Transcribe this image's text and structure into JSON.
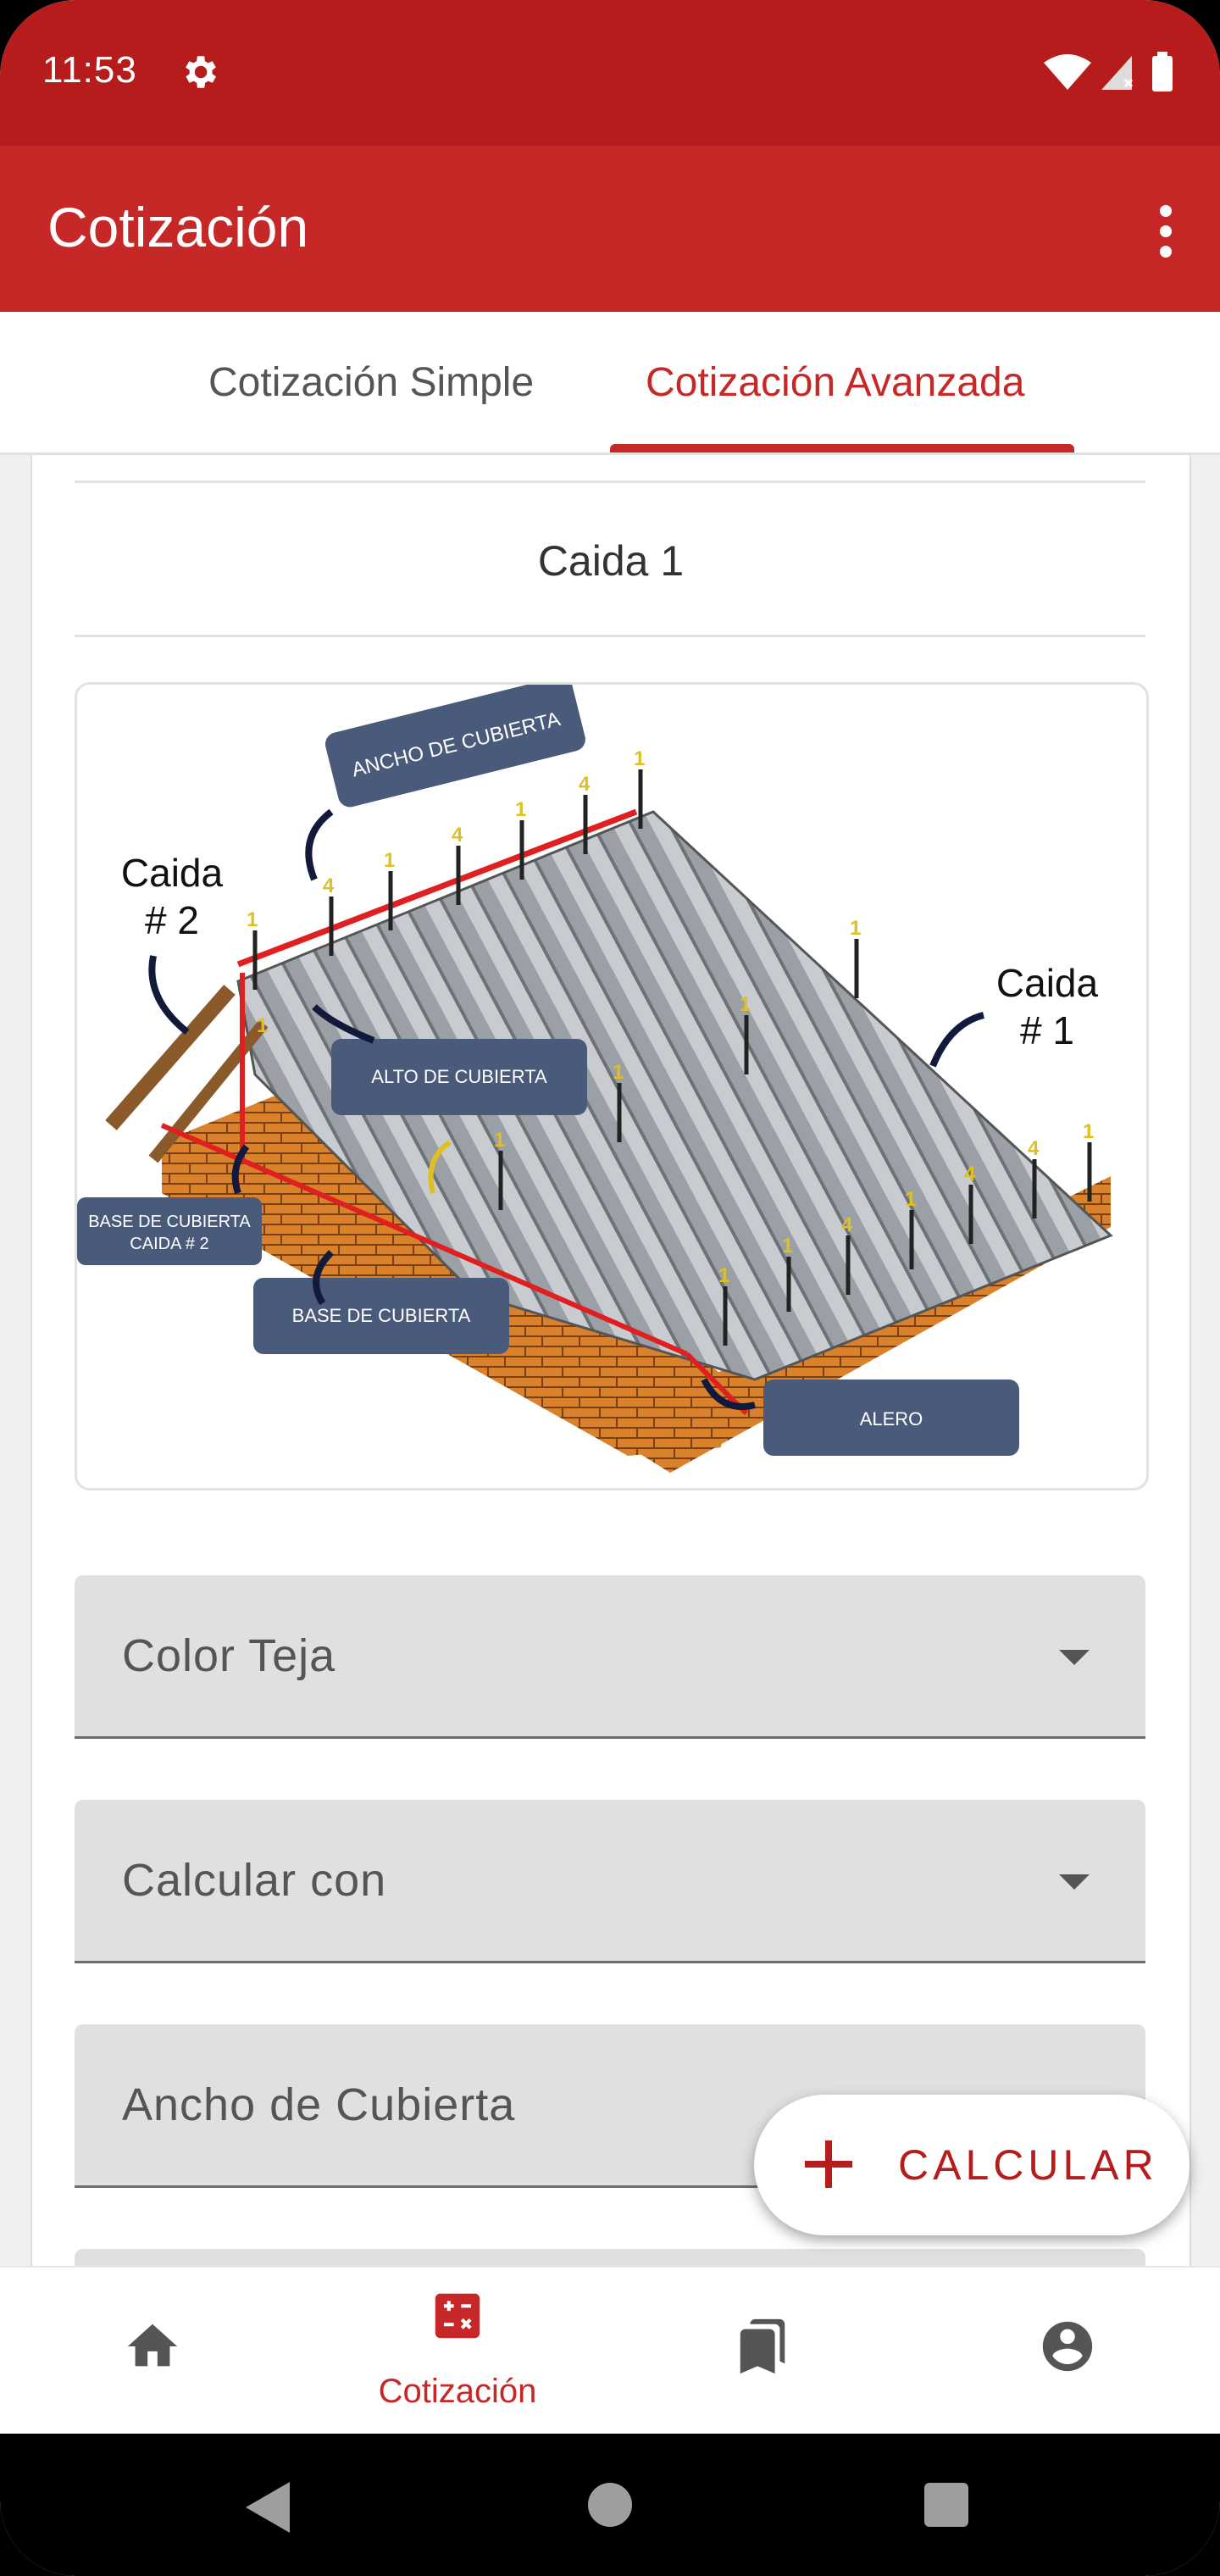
{
  "status_bar": {
    "time": "11:53"
  },
  "app_bar": {
    "title": "Cotización"
  },
  "tabs": [
    {
      "label": "Cotización Simple",
      "selected": false
    },
    {
      "label": "Cotización Avanzada",
      "selected": true
    }
  ],
  "section": {
    "title": "Caida 1"
  },
  "diagram": {
    "labels": {
      "ancho": "ANCHO DE CUBIERTA",
      "alto": "ALTO DE CUBIERTA",
      "base_caida2_line1": "BASE DE CUBIERTA",
      "base_caida2_line2": "CAIDA # 2",
      "base": "BASE DE CUBIERTA",
      "alero": "ALERO",
      "caida2_line1": "Caida",
      "caida2_line2": "# 2",
      "caida1_line1": "Caida",
      "caida1_line2": "# 1"
    },
    "screw_numbers": [
      "1",
      "4",
      "1",
      "4",
      "1",
      "4",
      "1",
      "1",
      "1",
      "1",
      "1",
      "4",
      "1",
      "4",
      "1",
      "4",
      "1",
      "1",
      "1"
    ]
  },
  "form": {
    "color_teja": "Color Teja",
    "calcular_con": "Calcular con",
    "ancho_cubierta": "Ancho de Cubierta"
  },
  "fab": {
    "label": "CALCULAR"
  },
  "bottom_nav": {
    "items": [
      {
        "icon": "home-icon",
        "label": ""
      },
      {
        "icon": "calculator-icon",
        "label": "Cotización",
        "selected": true
      },
      {
        "icon": "bookmarks-icon",
        "label": ""
      },
      {
        "icon": "account-icon",
        "label": ""
      }
    ]
  },
  "colors": {
    "status_bar": "#b71c1c",
    "app_bar": "#c62828",
    "accent": "#c62828"
  }
}
